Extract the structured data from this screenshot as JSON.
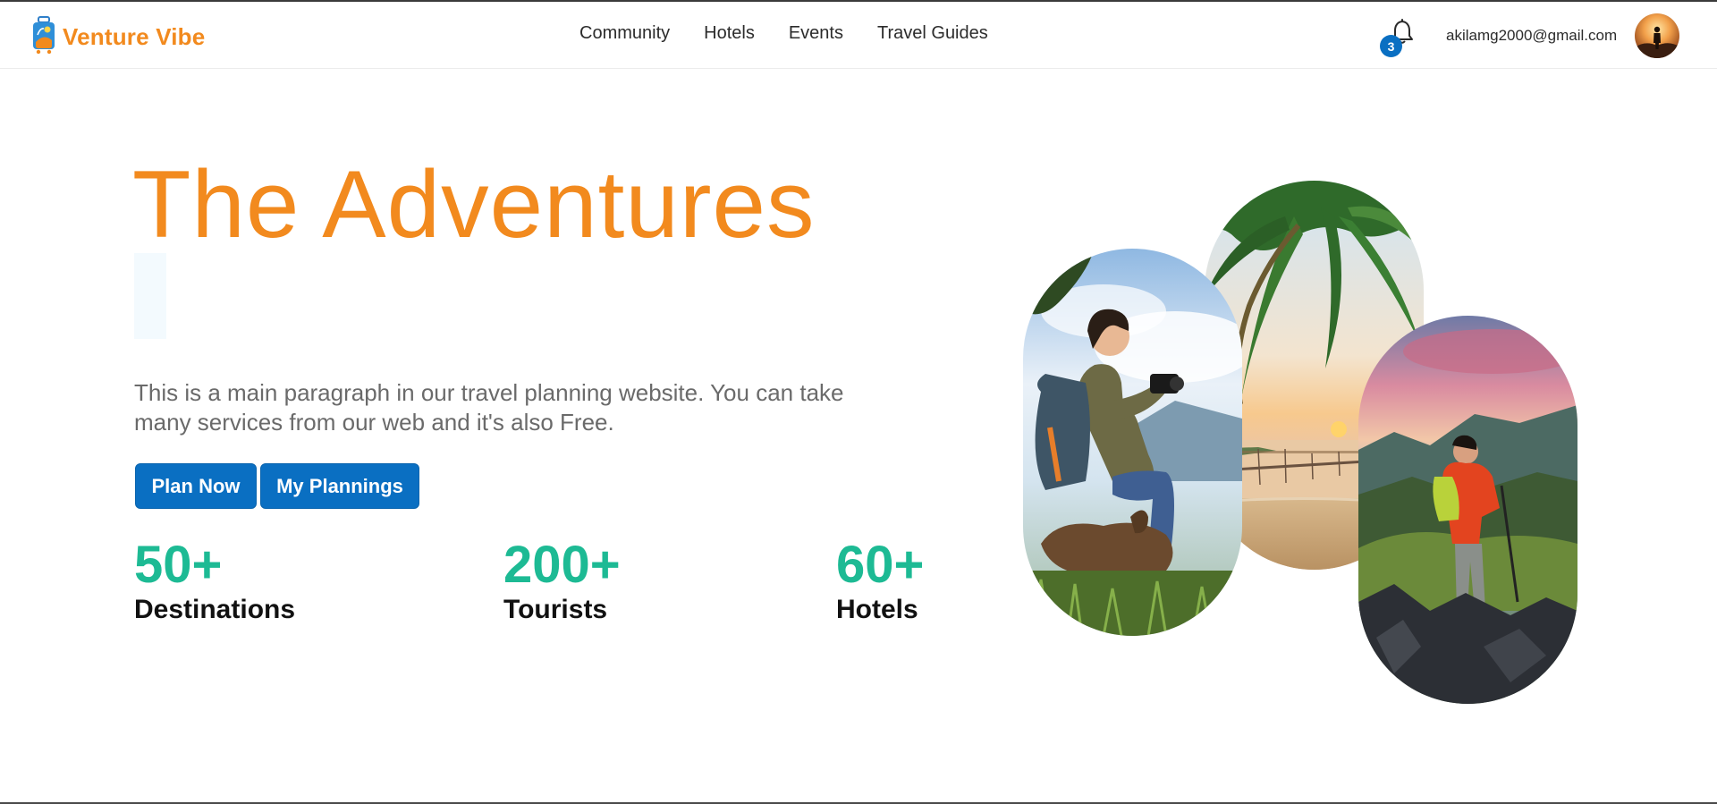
{
  "brand": {
    "name": "Venture Vibe",
    "logo_icon": "suitcase-icon",
    "color": "#f28a1e"
  },
  "nav": {
    "links": [
      "Community",
      "Hotels",
      "Events",
      "Travel Guides"
    ]
  },
  "notifications": {
    "icon": "bell-icon",
    "count": "3"
  },
  "user": {
    "email": "akilamg2000@gmail.com",
    "avatar_icon": "avatar-icon"
  },
  "hero": {
    "title": "The Adventures",
    "paragraph": "This is a main paragraph in our travel planning website. You can take many services from our web and it's also Free.",
    "buttons": {
      "plan_now": "Plan Now",
      "my_plannings": "My Plannings"
    },
    "stats": [
      {
        "value": "50+",
        "label": "Destinations"
      },
      {
        "value": "200+",
        "label": "Tourists"
      },
      {
        "value": "60+",
        "label": "Hotels"
      }
    ]
  },
  "images": [
    {
      "name": "hiker-with-camera-photo"
    },
    {
      "name": "beach-sunset-pier-photo"
    },
    {
      "name": "mountain-hiker-photo"
    }
  ],
  "colors": {
    "accent_orange": "#f28a1e",
    "primary_blue": "#0a6fc2",
    "stat_green": "#1dba94"
  }
}
